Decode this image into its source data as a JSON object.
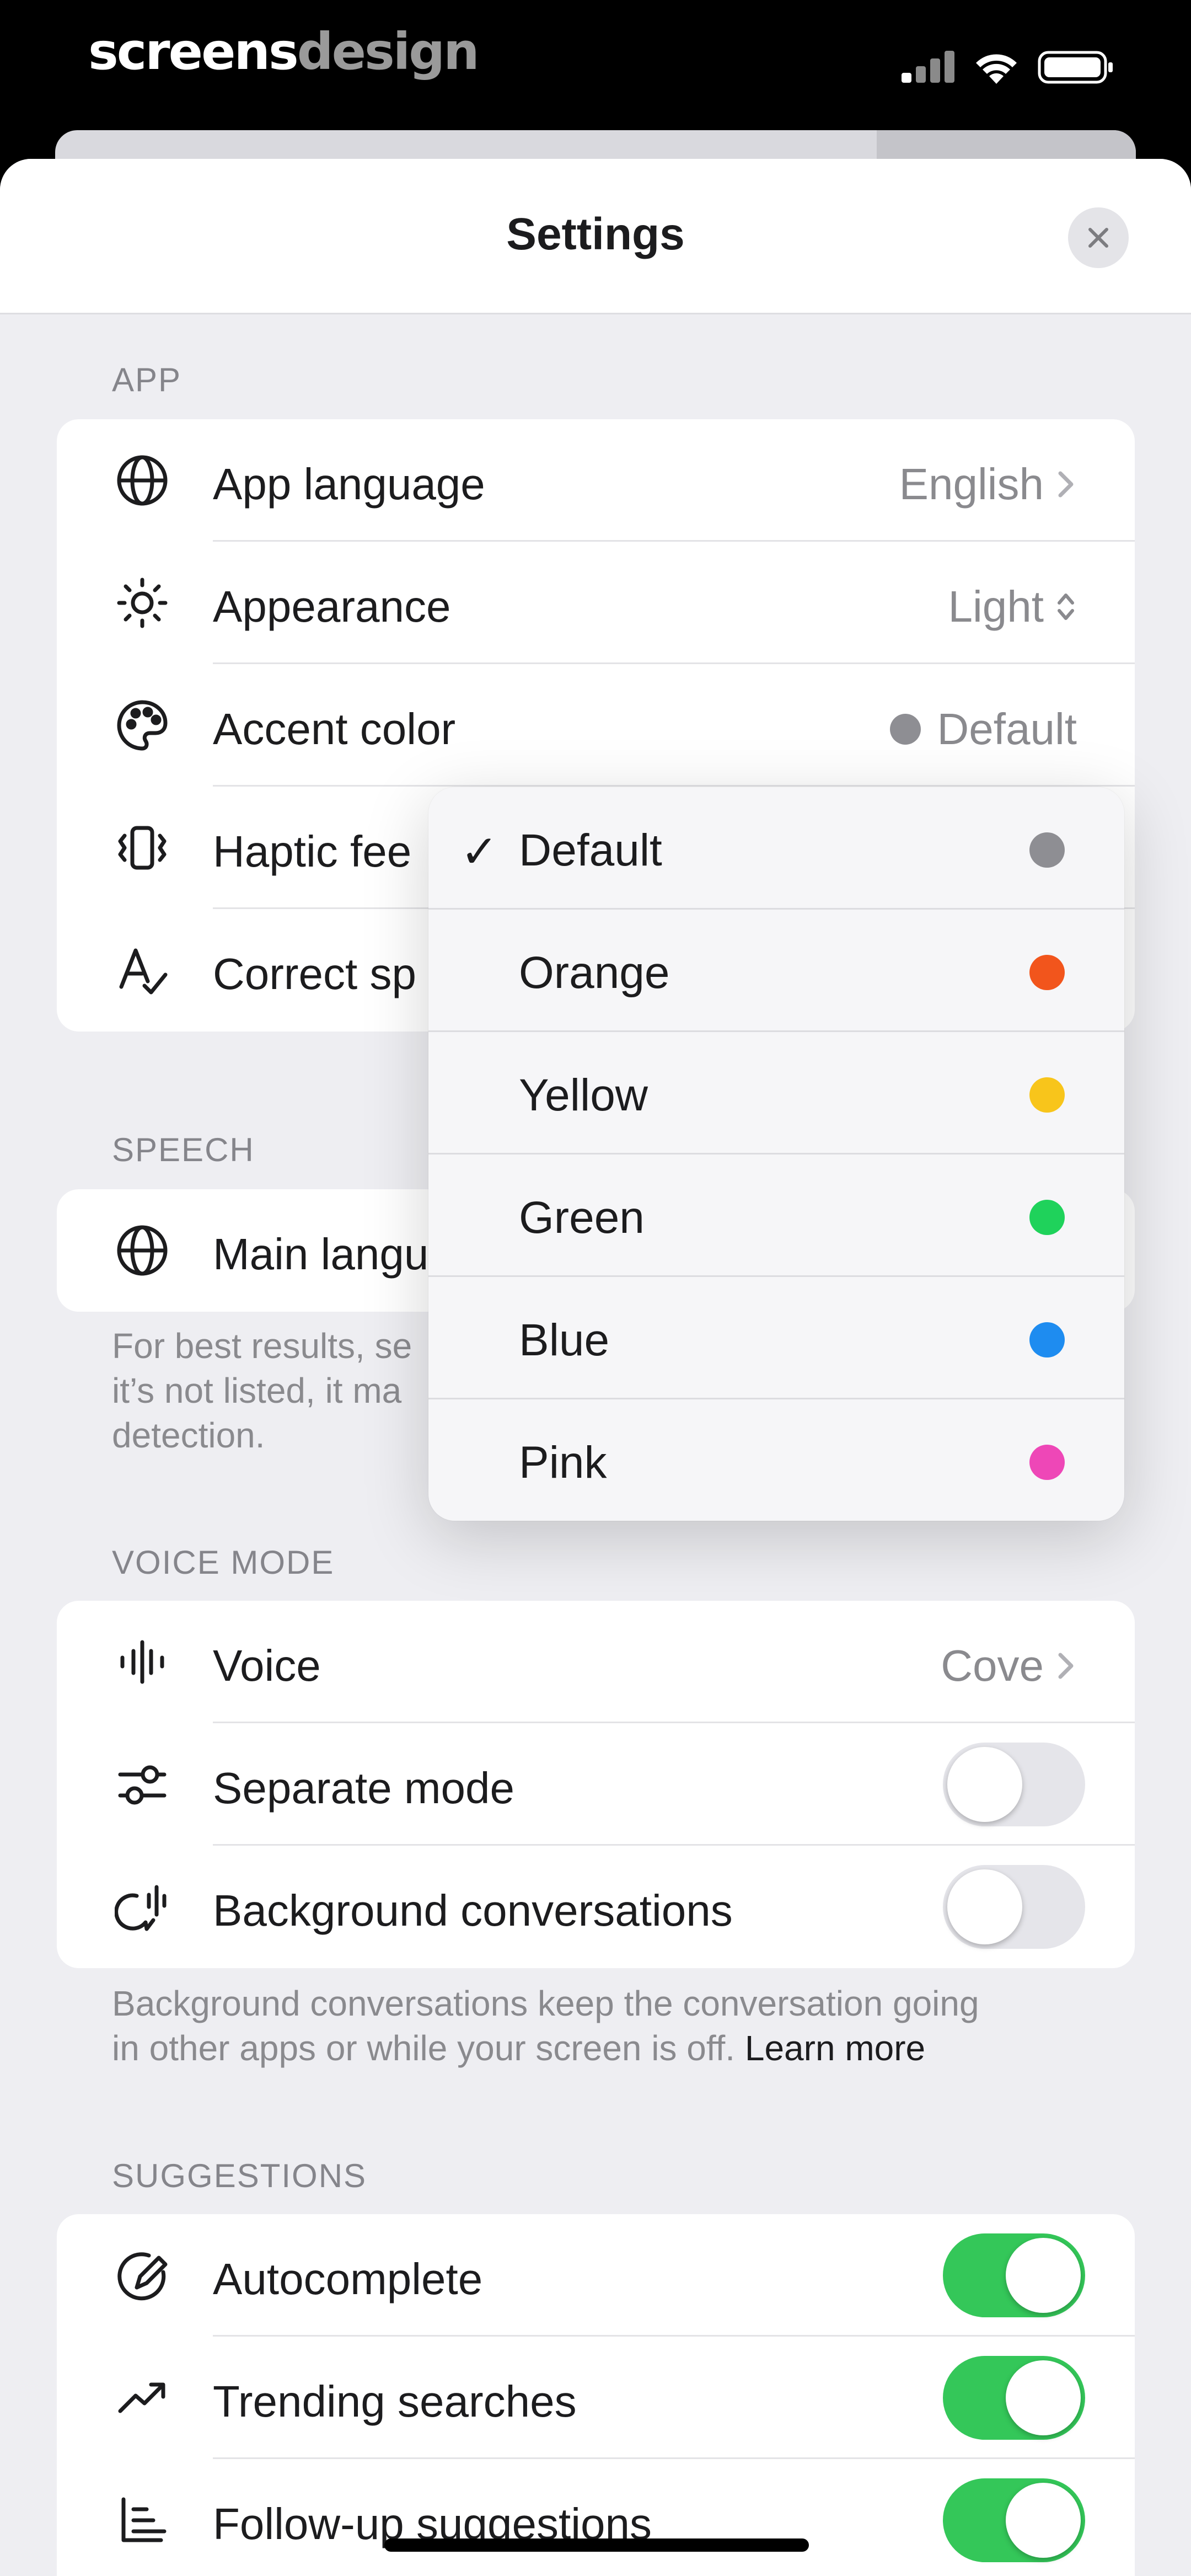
{
  "status_bar": {
    "brand_part1": "screens",
    "brand_part2": "design",
    "icons": [
      "signal-icon",
      "wifi-icon",
      "battery-icon"
    ]
  },
  "header": {
    "title": "Settings",
    "close_icon": "close-icon"
  },
  "app_section": {
    "label": "APP",
    "rows": [
      {
        "label": "App language",
        "value": "English",
        "icon": "globe-icon",
        "accessory": "chevron-right-icon"
      },
      {
        "label": "Appearance",
        "value": "Light",
        "icon": "sun-icon",
        "accessory": "chevron-updown-icon"
      },
      {
        "label": "Accent color",
        "value": "Default",
        "icon": "palette-icon",
        "dot_color": "#8e8e93"
      },
      {
        "label": "Haptic fee",
        "icon": "haptic-icon"
      },
      {
        "label": "Correct sp",
        "icon": "spellcheck-icon"
      }
    ]
  },
  "speech_section": {
    "label": "SPEECH",
    "rows": [
      {
        "label": "Main langu",
        "icon": "globe-icon"
      }
    ],
    "footnote_line1": "For best results, se",
    "footnote_line2": "it’s not listed, it ma",
    "footnote_line3": "detection."
  },
  "accent_menu": {
    "selected": "Default",
    "items": [
      {
        "label": "Default",
        "color": "#8e8e93",
        "checked": "✓"
      },
      {
        "label": "Orange",
        "color": "#f2551c"
      },
      {
        "label": "Yellow",
        "color": "#f8c51b"
      },
      {
        "label": "Green",
        "color": "#1fd25b"
      },
      {
        "label": "Blue",
        "color": "#1e8cf0"
      },
      {
        "label": "Pink",
        "color": "#ee47b7"
      }
    ]
  },
  "voice_section": {
    "label": "VOICE MODE",
    "rows": [
      {
        "label": "Voice",
        "value": "Cove",
        "icon": "waveform-icon",
        "accessory": "chevron-right-icon"
      },
      {
        "label": "Separate mode",
        "icon": "sliders-icon",
        "toggle": false
      },
      {
        "label": "Background conversations",
        "icon": "background-voice-icon",
        "toggle": false
      }
    ],
    "footnote_line1": "Background conversations keep the conversation going",
    "footnote_line2": "in other apps or while your screen is off.",
    "learn_more": "Learn more"
  },
  "suggestions_section": {
    "label": "SUGGESTIONS",
    "rows": [
      {
        "label": "Autocomplete",
        "icon": "autocomplete-icon",
        "toggle": true
      },
      {
        "label": "Trending searches",
        "icon": "trending-icon",
        "toggle": true
      },
      {
        "label": "Follow-up suggestions",
        "icon": "followup-icon",
        "toggle": true
      }
    ]
  },
  "colors": {
    "toggle_on": "#34c759",
    "toggle_off": "#e5e5ea",
    "background": "#eeeef2"
  }
}
